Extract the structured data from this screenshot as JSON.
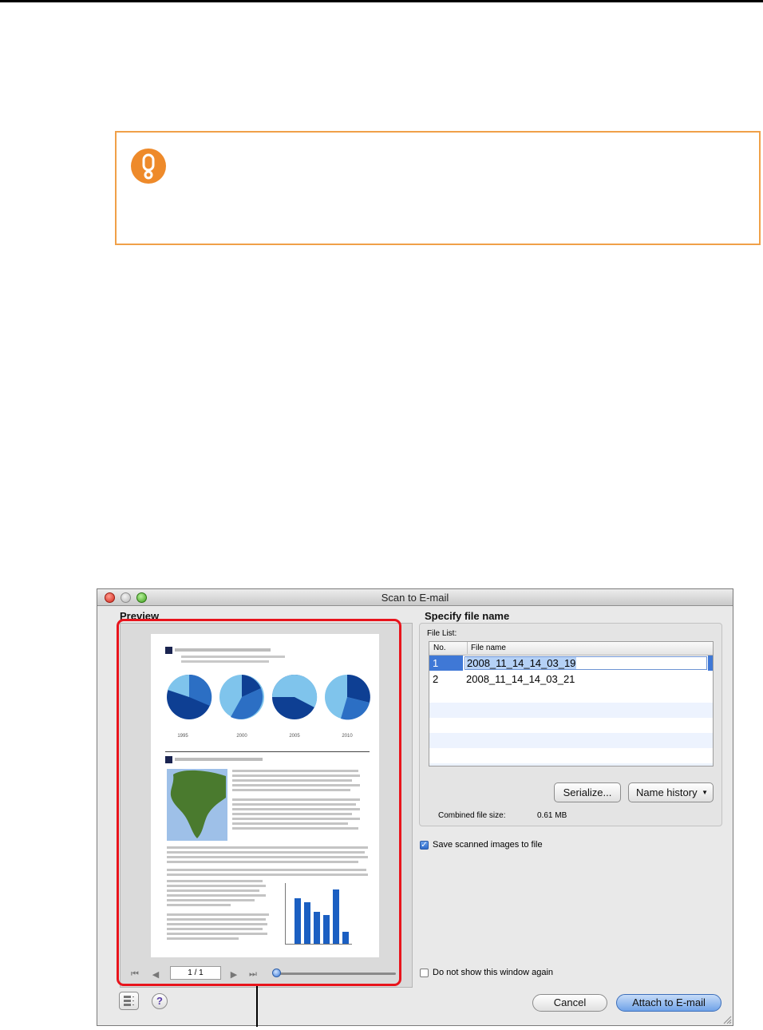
{
  "dialog": {
    "window_title": "Scan to E-mail",
    "preview": {
      "title": "Preview",
      "page_indicator": "1 / 1",
      "zoom_level": 0.03,
      "doc_year_labels": [
        "1995",
        "2000",
        "2005",
        "2010"
      ]
    },
    "specify": {
      "title": "Specify file name",
      "file_list_label": "File List:",
      "columns": [
        "No.",
        "File name"
      ],
      "rows": [
        {
          "no": "1",
          "name": "2008_11_14_14_03_19",
          "selected": true
        },
        {
          "no": "2",
          "name": "2008_11_14_14_03_21",
          "selected": false
        }
      ],
      "serialize_button": "Serialize...",
      "name_history_button": "Name history",
      "combined_label": "Combined file size:",
      "combined_value": "0.61  MB"
    },
    "save_checkbox": {
      "label": "Save scanned images to file",
      "checked": true
    },
    "dont_show_checkbox": {
      "label": "Do not show this window again",
      "checked": false
    },
    "cancel_button": "Cancel",
    "attach_button": "Attach to E-mail"
  },
  "colors": {
    "caution_border": "#f0a048",
    "caution_icon": "#ee8a2a",
    "highlight_frame": "#e8141c",
    "selection": "#3f78d6"
  },
  "icons": [
    "caution-icon",
    "close-icon",
    "minimize-icon",
    "zoom-icon",
    "first-page-icon",
    "previous-page-icon",
    "next-page-icon",
    "last-page-icon",
    "slider-knob",
    "dropdown-arrow-icon",
    "checkmark-icon",
    "list-view-icon",
    "help-icon",
    "resize-grip-icon"
  ]
}
